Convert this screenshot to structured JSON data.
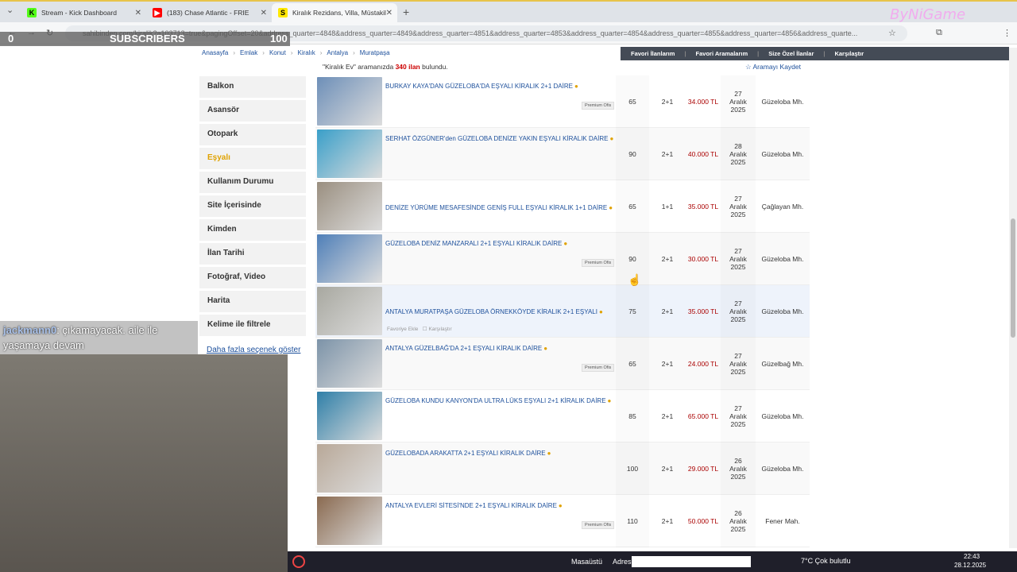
{
  "tabs": [
    {
      "label": "Stream - Kick Dashboard",
      "icon": "kick-icon",
      "color": "#53fc18"
    },
    {
      "label": "(183) Chase Atlantic - FRIE",
      "icon": "youtube-icon",
      "color": "#ff0000"
    },
    {
      "label": "Kiralık Rezidans, Villa, Müstakil",
      "icon": "sahibinden-icon",
      "color": "#ffe800"
    }
  ],
  "address_bar": "sahibinden.com/kiralik?a103713=true&pagingOffset=20&address_quarter=4848&address_quarter=4849&address_quarter=4851&address_quarter=4853&address_quarter=4854&address_quarter=4855&address_quarter=4856&address_quarte...",
  "overlay": {
    "left": "0",
    "label": "SUBSCRIBERS",
    "count": "100",
    "watermark": "ByNiGame"
  },
  "breadcrumb": [
    "Anasayfa",
    "Emlak",
    "Konut",
    "Kiralık",
    "Antalya",
    "Muratpaşa"
  ],
  "favbar": [
    "Favori İlanlarım",
    "Favori Aramalarım",
    "Size Özel İlanlar",
    "Karşılaştır"
  ],
  "result": {
    "pre": "\"Kiralık Ev\" aramanızda",
    "count": "340 ilan",
    "post": "bulundu."
  },
  "save_search": "Aramayı Kaydet",
  "filters": [
    "Balkon",
    "Asansör",
    "Otopark",
    "Eşyalı",
    "Kullanım Durumu",
    "Site İçerisinde",
    "Kimden",
    "İlan Tarihi",
    "Fotoğraf, Video",
    "Harita",
    "Kelime ile filtrele"
  ],
  "more_options": "Daha fazla seçenek göster",
  "listings": [
    {
      "title": "BURKAY KAYA'DAN GÜZELOBA'DA EŞYALI KİRALIK 2+1 DAİRE",
      "m2": "65",
      "rooms": "2+1",
      "price": "34.000 TL",
      "date": "27 Aralık 2025",
      "loc": "Güzeloba Mh.",
      "premium": "Premium Ofis",
      "img": "#6d8fb8"
    },
    {
      "title": "SERHAT ÖZGÜNER'den GÜZELOBA DENİZE YAKIN EŞYALI KİRALIK DAİRE",
      "m2": "90",
      "rooms": "2+1",
      "price": "40.000 TL",
      "date": "28 Aralık 2025",
      "loc": "Güzeloba Mh.",
      "premium": "",
      "img": "#3a9fc9"
    },
    {
      "title": "DENİZE YÜRÜME MESAFESİNDE GENİŞ FULL EŞYALI KİRALIK 1+1 DAİRE",
      "m2": "65",
      "rooms": "1+1",
      "price": "35.000 TL",
      "date": "27 Aralık 2025",
      "loc": "Çağlayan Mh.",
      "premium": "",
      "img": "#9a8f80"
    },
    {
      "title": "GÜZELOBA DENİZ MANZARALI 2+1 EŞYALI KİRALIK DAİRE",
      "m2": "90",
      "rooms": "2+1",
      "price": "30.000 TL",
      "date": "27 Aralık 2025",
      "loc": "Güzeloba Mh.",
      "premium": "Premium Ofis",
      "img": "#4f7fb8"
    },
    {
      "title": "ANTALYA MURATPAŞA GÜZELOBA ÖRNEKKÖYDE KİRALIK 2+1 EŞYALI",
      "m2": "75",
      "rooms": "2+1",
      "price": "35.000 TL",
      "date": "27 Aralık 2025",
      "loc": "Güzeloba Mh.",
      "premium": "",
      "img": "#a8a8a0"
    },
    {
      "title": "ANTALYA GÜZELBAĞ'DA 2+1 EŞYALI KİRALIK DAİRE",
      "m2": "65",
      "rooms": "2+1",
      "price": "24.000 TL",
      "date": "27 Aralık 2025",
      "loc": "Güzelbağ Mh.",
      "premium": "Premium Ofis",
      "img": "#7c93a8"
    },
    {
      "title": "GÜZELOBA KUNDU KANYON'DA ULTRA LÜKS EŞYALI 2+1 KİRALIK DAİRE",
      "m2": "85",
      "rooms": "2+1",
      "price": "65.000 TL",
      "date": "27 Aralık 2025",
      "loc": "Güzeloba Mh.",
      "premium": "",
      "img": "#2f7fa8"
    },
    {
      "title": "GÜZELOBADA ARAKATTA 2+1 EŞYALI KİRALIK DAİRE",
      "m2": "100",
      "rooms": "2+1",
      "price": "29.000 TL",
      "date": "26 Aralık 2025",
      "loc": "Güzeloba Mh.",
      "premium": "",
      "img": "#b8a898"
    },
    {
      "title": "ANTALYA EVLERİ SİTESİ'NDE 2+1 EŞYALI KİRALIK DAİRE",
      "m2": "110",
      "rooms": "2+1",
      "price": "50.000 TL",
      "date": "26 Aralık 2025",
      "loc": "Fener Mah.",
      "premium": "Premium Ofis",
      "img": "#8a6a50"
    }
  ],
  "row_actions": {
    "fav": "Favoriye Ekle",
    "compare": "Karşılaştır"
  },
  "chat": {
    "user": "jackmann0",
    "message": ": çıkamayacak. aile ile yaşamaya devam"
  },
  "taskbar": {
    "desktop": "Masaüstü",
    "address": "Adres",
    "weather": "7°C  Çok bulutlu",
    "time": "22:43",
    "date": "28.12.2025"
  }
}
